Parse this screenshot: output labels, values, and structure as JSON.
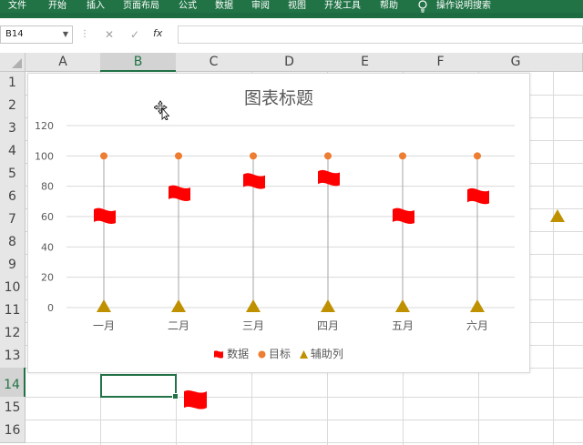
{
  "ribbon": {
    "tabs": [
      "文件",
      "开始",
      "插入",
      "页面布局",
      "公式",
      "数据",
      "审阅",
      "视图",
      "开发工具",
      "帮助"
    ],
    "tell_me_icon": "lightbulb-icon",
    "tell_me": "操作说明搜索"
  },
  "formula_bar": {
    "name_box": "B14",
    "cancel_icon": "cross-icon",
    "enter_icon": "check-icon",
    "fx_label": "fx",
    "formula": ""
  },
  "sheet": {
    "columns": [
      "A",
      "B",
      "C",
      "D",
      "E",
      "F",
      "G"
    ],
    "rows": [
      "1",
      "2",
      "3",
      "4",
      "5",
      "6",
      "7",
      "8",
      "9",
      "10",
      "11",
      "12",
      "13",
      "14",
      "15",
      "16"
    ],
    "selected_cell": "B14",
    "selected_column": "B",
    "selected_row": "14"
  },
  "colors": {
    "ribbon": "#217346",
    "flag": "#ff0000",
    "target_dot": "#ed7d31",
    "helper_triangle": "#bf9000",
    "stem": "#a6a6a6"
  },
  "chart_data": {
    "type": "line",
    "title": "图表标题",
    "categories": [
      "一月",
      "二月",
      "三月",
      "四月",
      "五月",
      "六月"
    ],
    "series": [
      {
        "name": "数据",
        "marker": "flag-icon",
        "values": [
          60,
          75,
          83,
          85,
          60,
          73
        ]
      },
      {
        "name": "目标",
        "marker": "circle",
        "values": [
          100,
          100,
          100,
          100,
          100,
          100
        ]
      },
      {
        "name": "辅助列",
        "marker": "triangle",
        "values": [
          0,
          0,
          0,
          0,
          0,
          0
        ]
      }
    ],
    "y_ticks": [
      "0",
      "20",
      "40",
      "60",
      "80",
      "100",
      "120"
    ],
    "ylim": [
      0,
      120
    ],
    "grid": true,
    "legend_position": "bottom"
  }
}
